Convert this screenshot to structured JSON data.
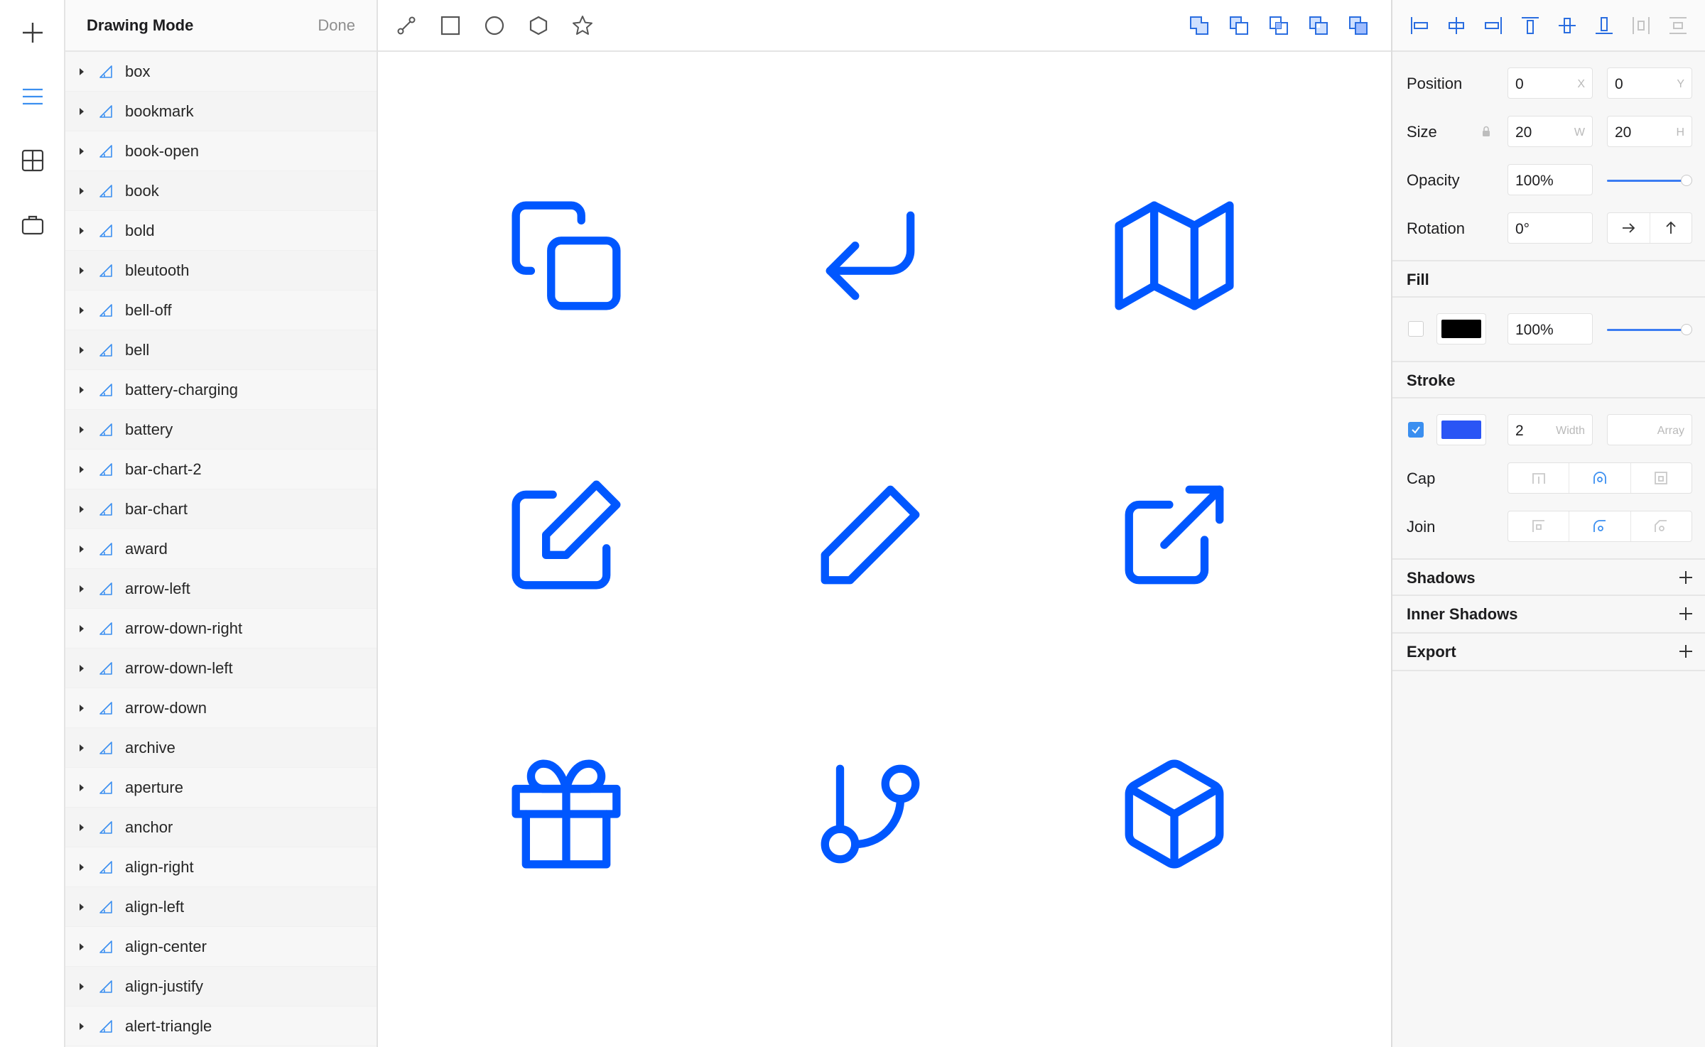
{
  "rail": {
    "items": [
      {
        "icon": "plus-icon"
      },
      {
        "icon": "menu-icon",
        "active": true
      },
      {
        "icon": "grid-icon"
      },
      {
        "icon": "briefcase-icon"
      }
    ]
  },
  "layers": {
    "title": "Drawing Mode",
    "done_label": "Done",
    "items": [
      "box",
      "bookmark",
      "book-open",
      "book",
      "bold",
      "bleutooth",
      "bell-off",
      "bell",
      "battery-charging",
      "battery",
      "bar-chart-2",
      "bar-chart",
      "award",
      "arrow-left",
      "arrow-down-right",
      "arrow-down-left",
      "arrow-down",
      "archive",
      "aperture",
      "anchor",
      "align-right",
      "align-left",
      "align-center",
      "align-justify",
      "alert-triangle"
    ]
  },
  "toolbar": {
    "tools": [
      "pen-tool-icon",
      "rectangle-icon",
      "oval-icon",
      "polygon-icon",
      "star-icon"
    ],
    "boolean_ops": [
      "union-icon",
      "subtract-icon",
      "intersect-icon",
      "difference-icon",
      "flatten-icon"
    ]
  },
  "canvas": {
    "accent": "#0057ff",
    "icons": [
      "copy-icon",
      "corner-down-left-icon",
      "map-icon",
      "edit-icon",
      "edit-2-icon",
      "external-link-icon",
      "gift-icon",
      "git-branch-icon",
      "box-icon"
    ]
  },
  "inspector": {
    "align_tools": [
      "align-left-edge-icon",
      "align-horizontal-center-icon",
      "align-right-edge-icon",
      "align-top-edge-icon",
      "align-vertical-center-icon",
      "align-bottom-edge-icon",
      "distribute-horizontal-icon",
      "distribute-vertical-icon"
    ],
    "position": {
      "label": "Position",
      "x": "0",
      "x_unit": "X",
      "y": "0",
      "y_unit": "Y"
    },
    "size": {
      "label": "Size",
      "w": "20",
      "w_unit": "W",
      "h": "20",
      "h_unit": "H"
    },
    "opacity": {
      "label": "Opacity",
      "value": "100%",
      "level": 1.0
    },
    "rotation": {
      "label": "Rotation",
      "value": "0°"
    },
    "fill": {
      "title": "Fill",
      "enabled": false,
      "color": "#000000",
      "opacity": "100%",
      "level": 1.0
    },
    "stroke": {
      "title": "Stroke",
      "enabled": true,
      "color": "#2a55f5",
      "width": "2",
      "width_unit": "Width",
      "array_unit": "Array"
    },
    "cap": {
      "label": "Cap",
      "selected": 1
    },
    "join": {
      "label": "Join",
      "selected": 1
    },
    "sections": [
      "Shadows",
      "Inner Shadows",
      "Export"
    ]
  }
}
